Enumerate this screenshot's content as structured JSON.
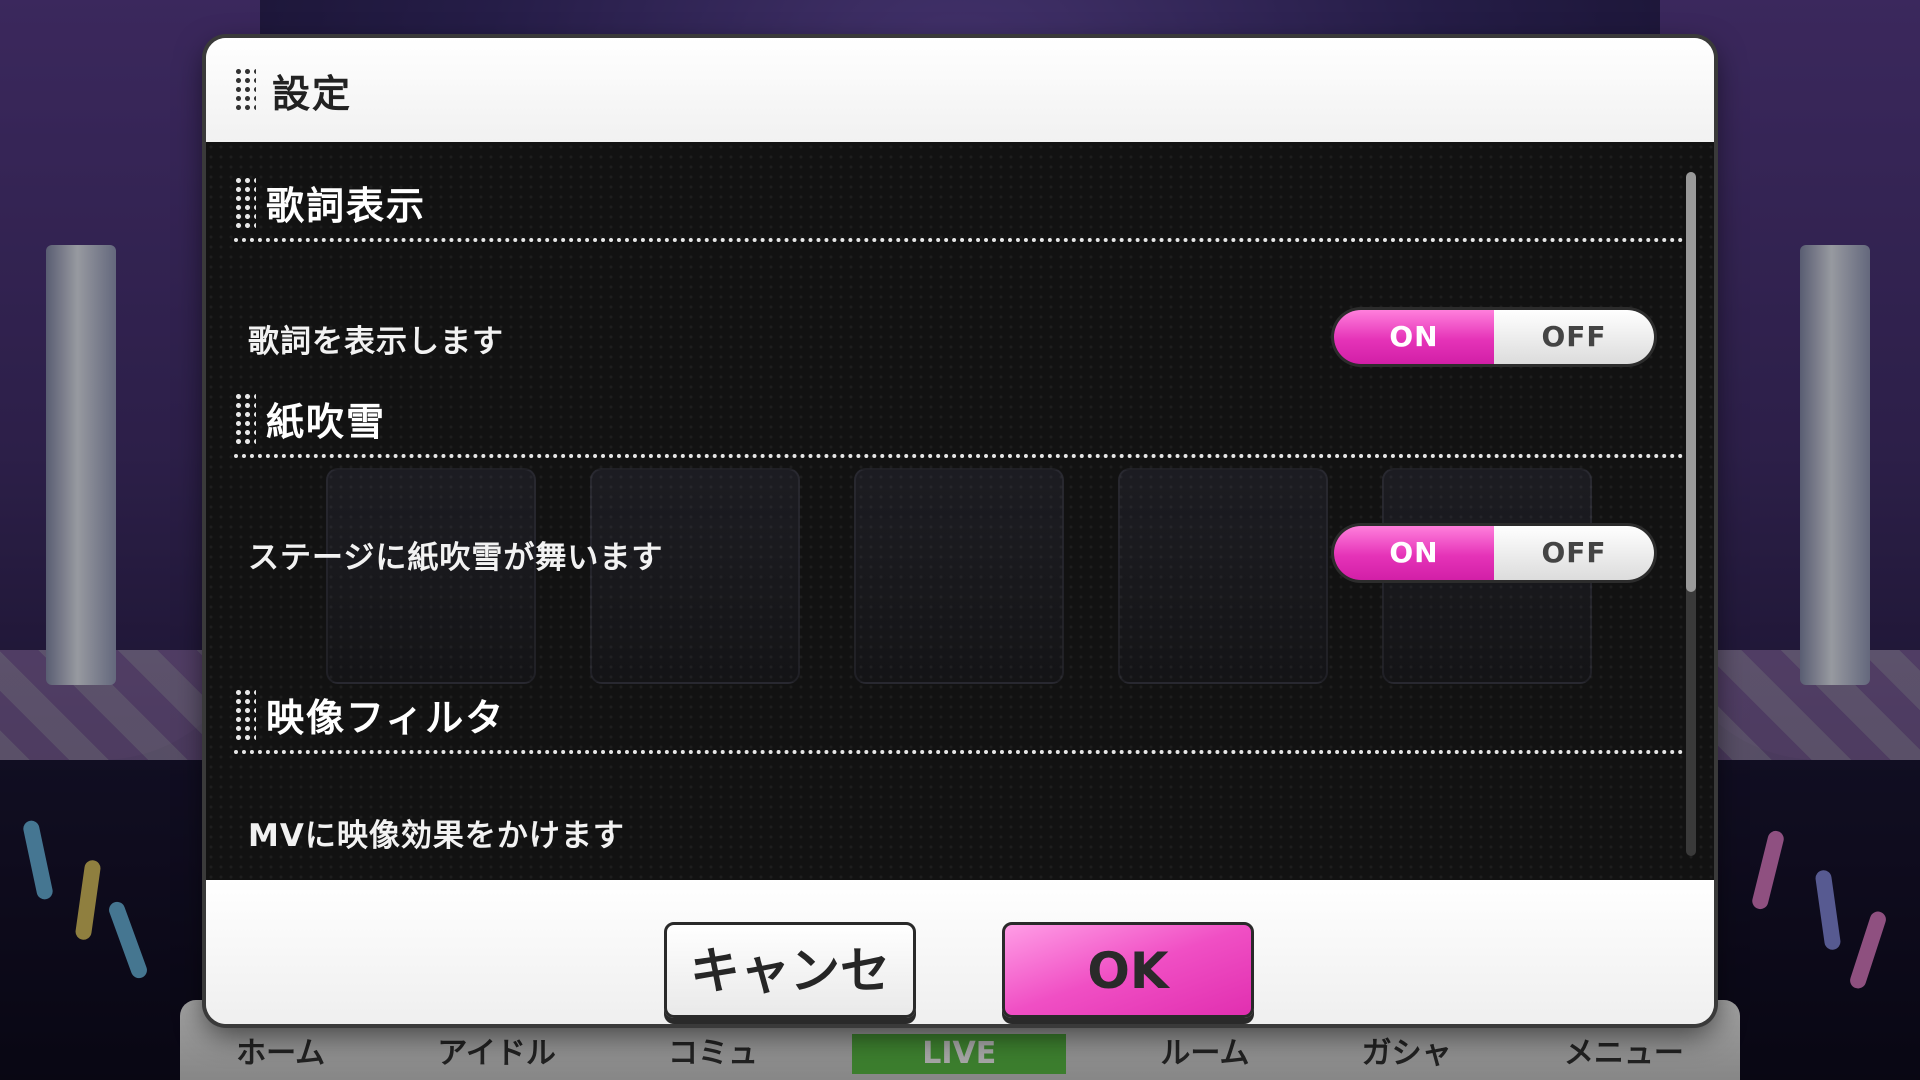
{
  "dialog": {
    "title": "設定",
    "ok_label": "OK",
    "cancel_label": "キャンセル"
  },
  "sections": [
    {
      "title": "歌詞表示",
      "label": "歌詞を表示します",
      "toggle": {
        "on": "ON",
        "off": "OFF",
        "selected": "ON"
      }
    },
    {
      "title": "紙吹雪",
      "label": "ステージに紙吹雪が舞います",
      "toggle": {
        "on": "ON",
        "off": "OFF",
        "selected": "ON"
      }
    },
    {
      "title": "映像フィルタ",
      "label": "MVに映像効果をかけます"
    }
  ],
  "bottom_nav": {
    "items": [
      "ホーム",
      "アイドル",
      "コミュ",
      "LIVE",
      "ルーム",
      "ガシャ",
      "メニュー"
    ],
    "active": "LIVE"
  },
  "colors": {
    "accent_pink": "#e533b8",
    "body_dark": "#121212",
    "nav_active_green": "#5dc247"
  }
}
